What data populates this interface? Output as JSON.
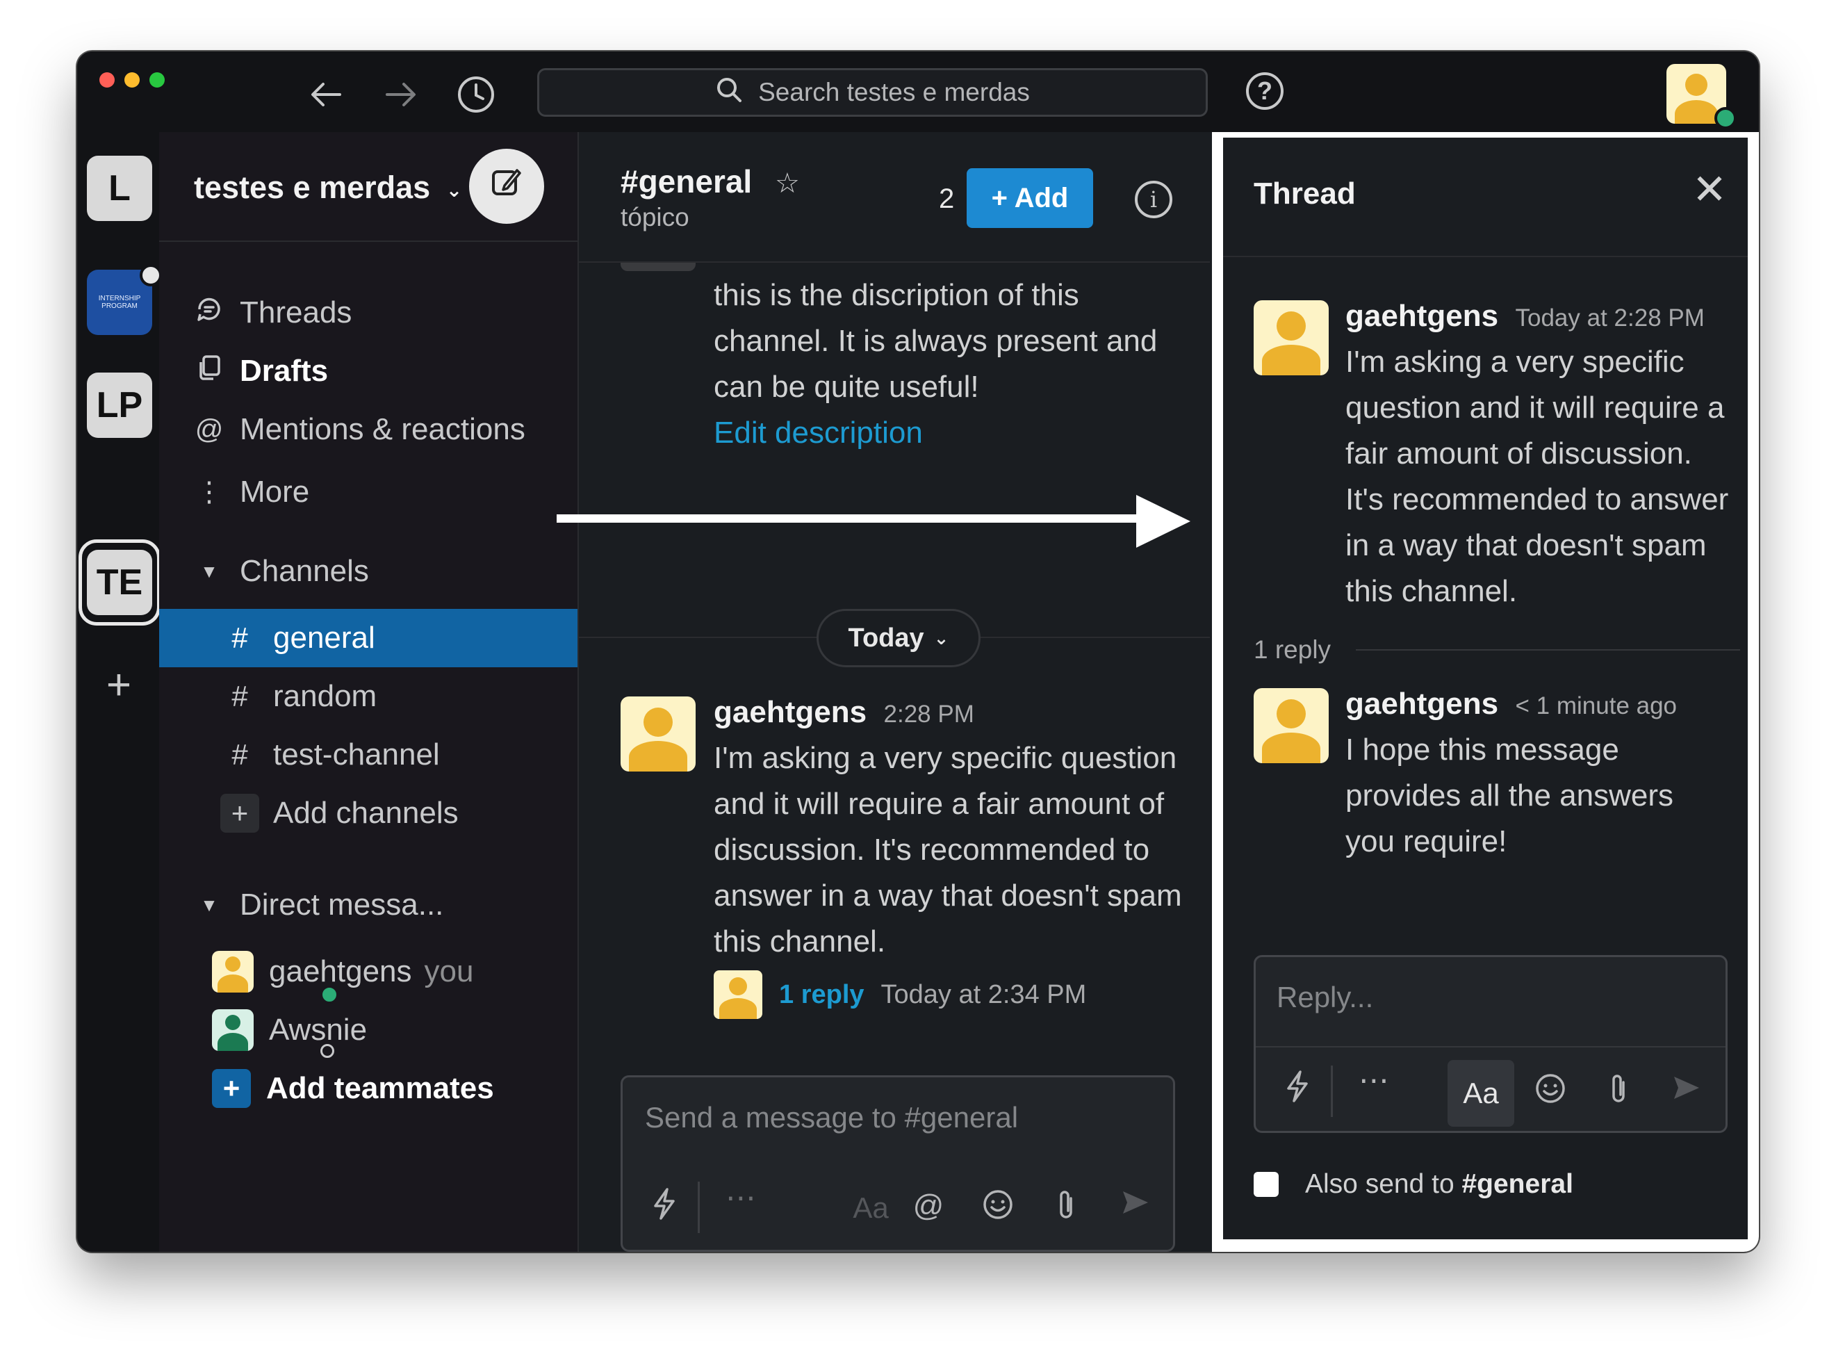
{
  "titlebar": {
    "search_placeholder": "Search testes e merdas",
    "help_label": "?"
  },
  "rail": {
    "workspaces": [
      {
        "label": "L"
      },
      {
        "label": "INTERNSHIP PROGRAM"
      },
      {
        "label": "LP"
      },
      {
        "label": "TE"
      }
    ],
    "add_label": "+"
  },
  "sidebar": {
    "workspace_name": "testes e merdas",
    "nav": [
      {
        "label": "Threads"
      },
      {
        "label": "Drafts"
      },
      {
        "label": "Mentions & reactions"
      },
      {
        "label": "More"
      }
    ],
    "channels_header": "Channels",
    "channels": [
      {
        "name": "general"
      },
      {
        "name": "random"
      },
      {
        "name": "test-channel"
      }
    ],
    "add_channels": "Add channels",
    "dm_header": "Direct messa...",
    "dms": [
      {
        "name": "gaehtgens",
        "suffix": "you"
      },
      {
        "name": "Awsnie",
        "suffix": ""
      }
    ],
    "add_teammates": "Add teammates"
  },
  "channel": {
    "title": "#general",
    "topic": "tópico",
    "member_count": "2",
    "add_button": "+ Add",
    "description_partial": "channel.",
    "description": "this is the discription of this channel. It is always present and can be quite useful!",
    "edit_description": "Edit description",
    "date_divider": "Today",
    "message": {
      "author": "gaehtgens",
      "time": "2:28 PM",
      "body": "I'm asking a very specific question and it will require a fair amount of discussion. It's recommended to answer in a way that doesn't spam  this channel.",
      "reply_count": "1 reply",
      "reply_time": "Today at 2:34 PM"
    },
    "composer_placeholder": "Send a message to #general",
    "composer_format_label": "Aa"
  },
  "thread": {
    "title": "Thread",
    "parent": {
      "author": "gaehtgens",
      "time": "Today at 2:28 PM",
      "body": "I'm asking a very specific question and it will require a fair amount of discussion. It's recommended to answer in a way that doesn't spam  this channel."
    },
    "reply_count": "1 reply",
    "reply": {
      "author": "gaehtgens",
      "time": "< 1 minute ago",
      "body": "I hope this message provides all the answers you require!"
    },
    "composer_placeholder": "Reply...",
    "composer_format_label": "Aa",
    "also_send_prefix": "Also send to",
    "also_send_channel": "#general"
  },
  "colors": {
    "accent_blue": "#1164a3",
    "button_blue": "#1d8ad2",
    "link_blue": "#1d9bd1",
    "presence_green": "#2bac76",
    "avatar_yellow": "#ecb22e"
  }
}
